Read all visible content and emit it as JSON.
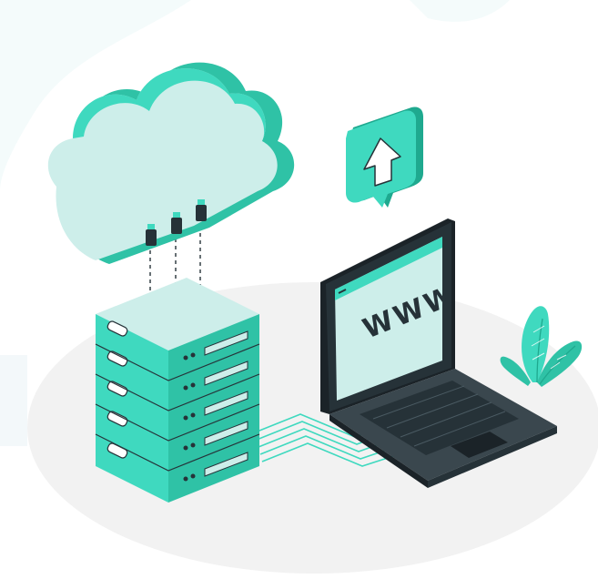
{
  "illustration": {
    "laptop_screen_text": "WWW",
    "colors": {
      "accent": "#3fd9bf",
      "accent_dark": "#1fa98f",
      "cloud_face": "#cdeeea",
      "dark": "#263238",
      "floor": "#f3f3f3",
      "background": "#ffffff"
    },
    "icons": [
      "cloud-icon",
      "server-rack-icon",
      "laptop-icon",
      "upload-bubble-icon",
      "plant-icon"
    ]
  }
}
